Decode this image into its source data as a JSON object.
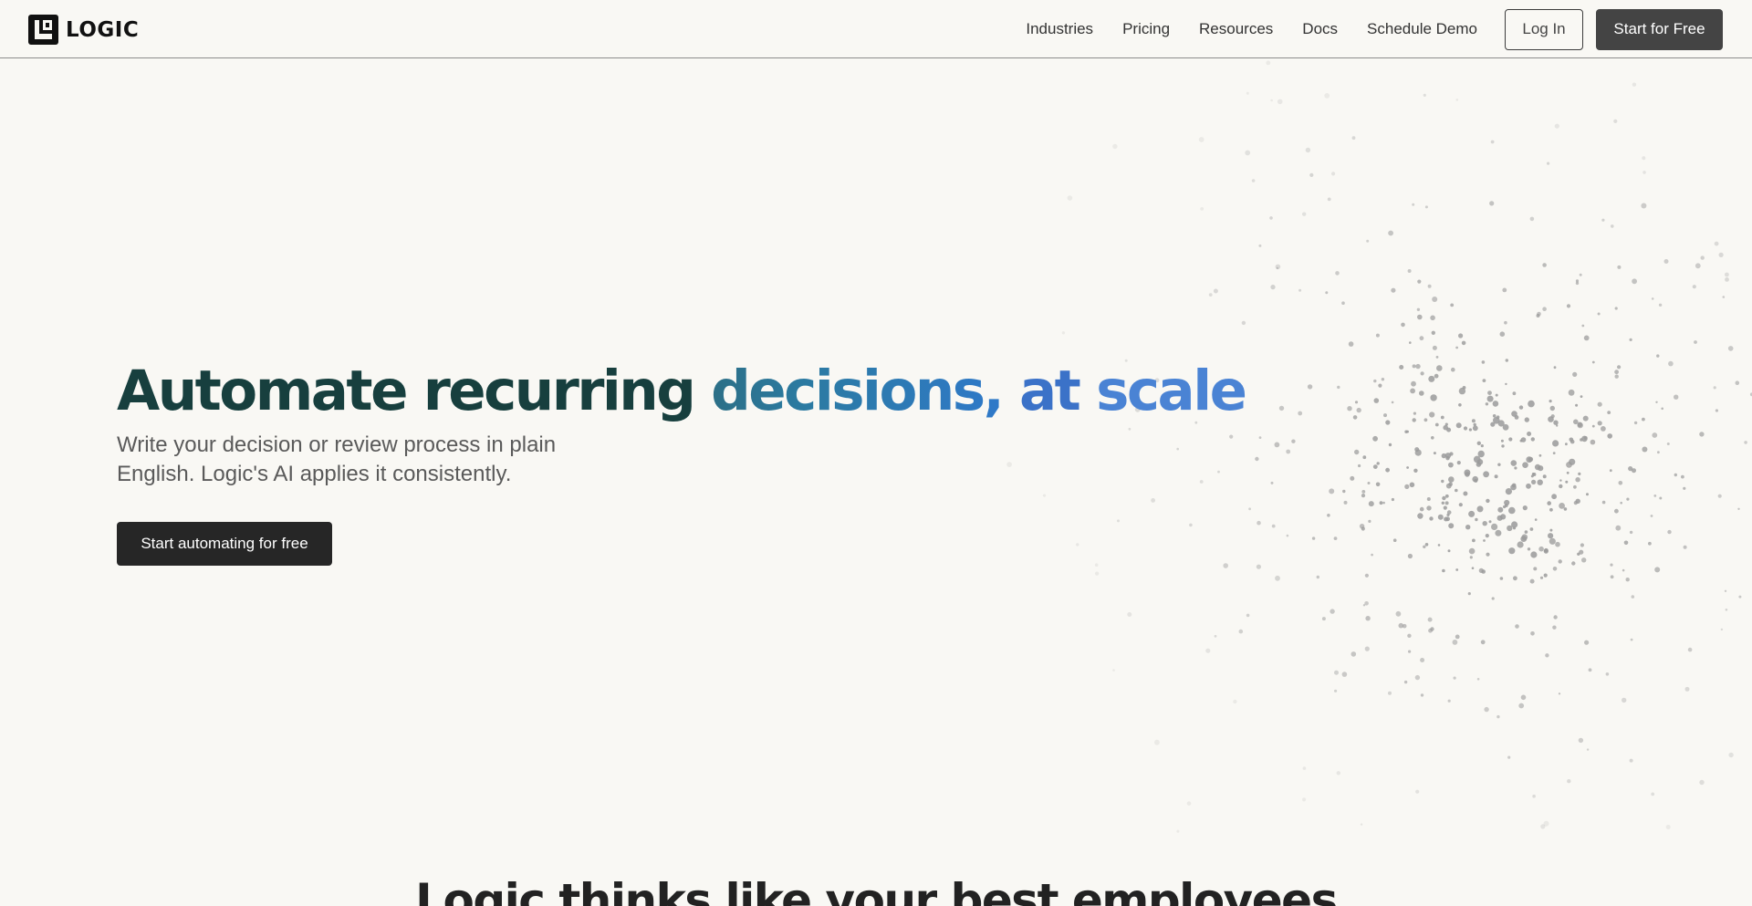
{
  "brand": {
    "name": "LOGIC",
    "logo_icon": "logic-logo-mark"
  },
  "nav": {
    "links": [
      "Industries",
      "Pricing",
      "Resources",
      "Docs",
      "Schedule Demo"
    ],
    "login_label": "Log In",
    "start_label": "Start for Free"
  },
  "hero": {
    "title_part1": "Automate recurring ",
    "title_part2": "decisions,",
    "title_part3": " at ",
    "title_part4": "scale",
    "subtitle": "Write your decision or review process in plain English. Logic's AI applies it consistently.",
    "cta_label": "Start automating for free"
  },
  "section": {
    "heading": "Logic thinks like your best employees"
  },
  "colors": {
    "background": "#f9f8f4",
    "title_dark": "#173f3e",
    "title_blue": "#3b72c8",
    "button_dark": "#262626",
    "particle": "#9a9a9a"
  }
}
